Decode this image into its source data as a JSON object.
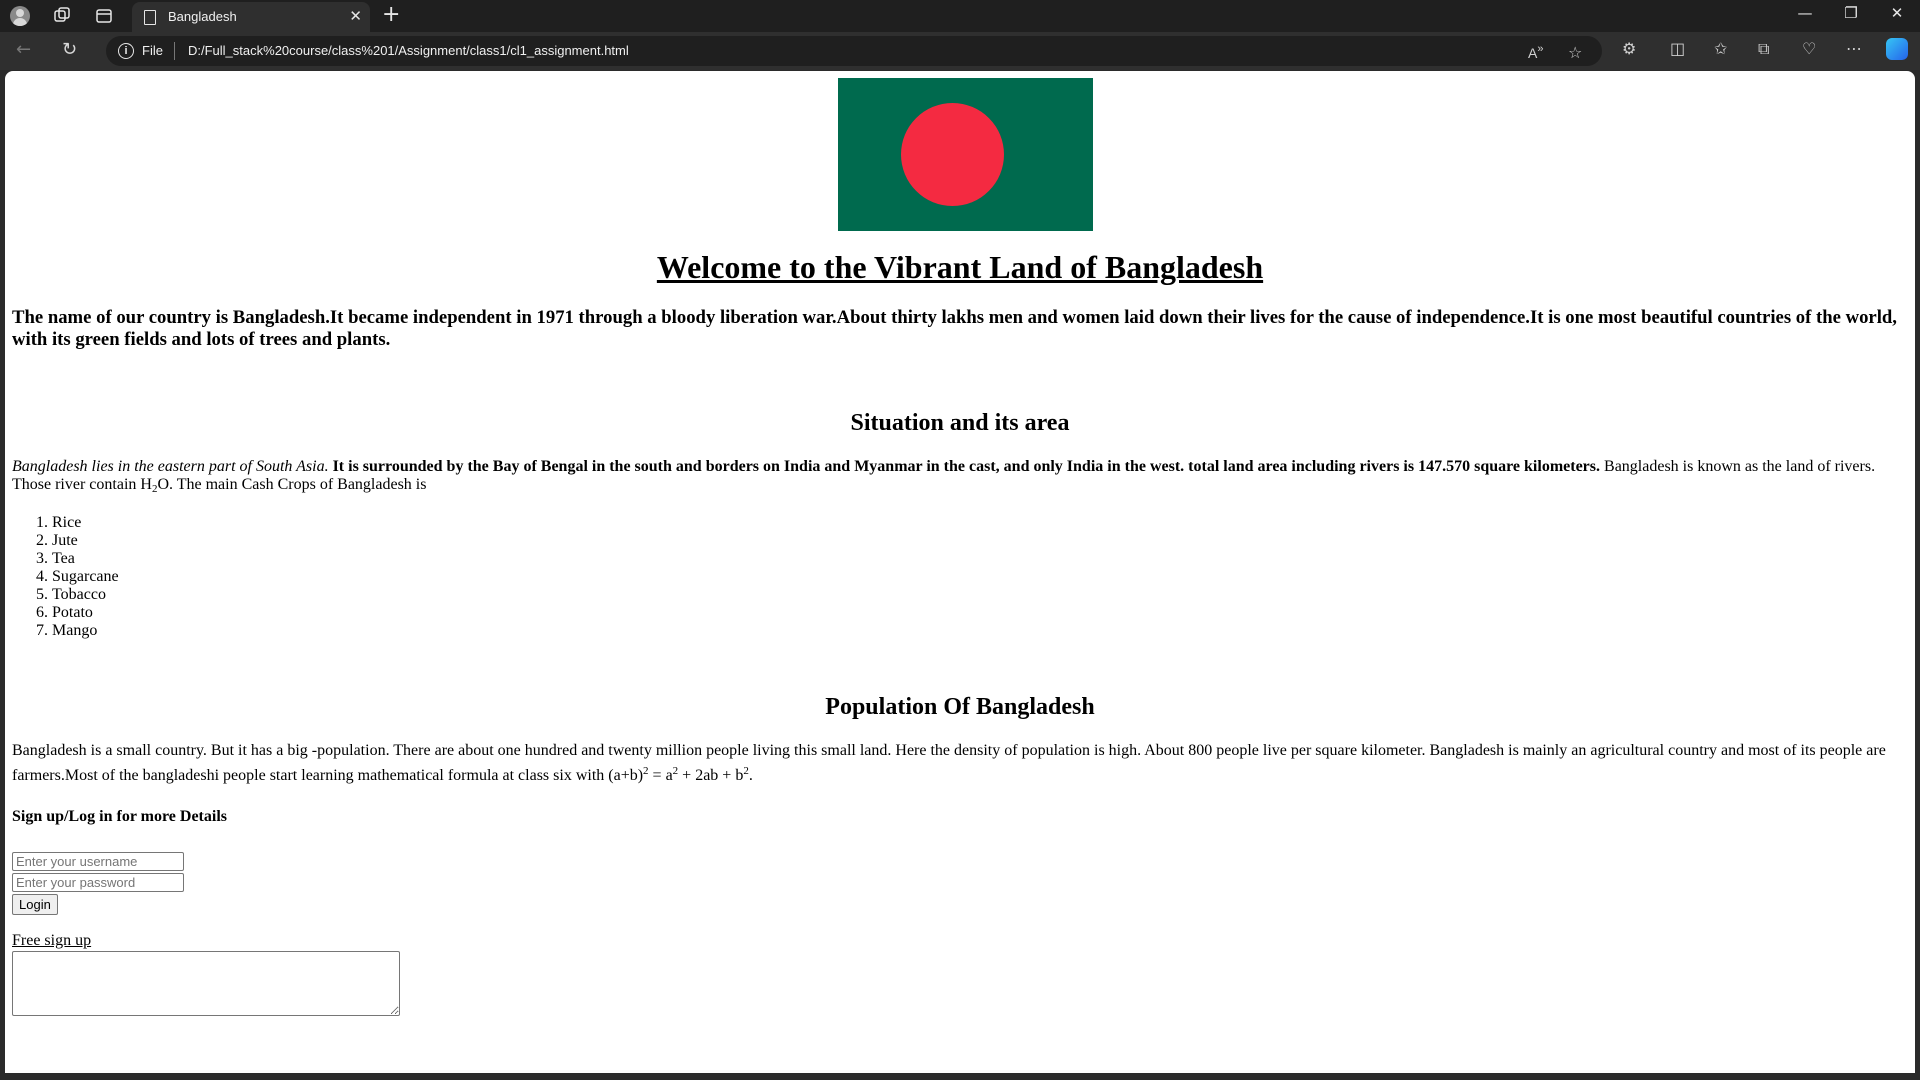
{
  "browser": {
    "tab_title": "Bangladesh",
    "tab_close": "✕",
    "new_tab": "+",
    "file_label": "File",
    "url": "D:/Full_stack%20course/class%201/Assignment/class1/cl1_assignment.html",
    "window_controls": [
      "—",
      "❐",
      "✕"
    ]
  },
  "page": {
    "heading": "Welcome to the Vibrant Land of Bangladesh",
    "intro": "The name of our country is Bangladesh.It became independent in 1971 through a bloody liberation war.About thirty lakhs men and women laid down their lives for the cause of independence.It is one most beautiful countries of the world, with its green fields and lots of trees and plants.",
    "situation_heading": "Situation and its area",
    "situation_italic": "Bangladesh lies in the eastern part of South Asia.",
    "situation_bold": "It is surrounded by the Bay of Bengal in the south and borders on India and Myanmar in the cast, and only India in the west. total land area including rivers is 147.570 square kilometers.",
    "situation_text1": "Bangladesh is known as the land of rivers. Those river contain H",
    "water_sub": "2",
    "situation_text2": "O. The main Cash Crops of Bangladesh is",
    "crops": [
      "Rice",
      "Jute",
      "Tea",
      "Sugarcane",
      "Tobacco",
      "Potato",
      "Mango"
    ],
    "population_heading": "Population Of Bangladesh",
    "population_text": "Bangladesh is a small country. But it has a big -population. There are about one hundred and twenty million people living this small land. Here the density of population is high. About 800 people live per square kilometer. Bangladesh is mainly an agricultural country and most of its people are farmers.Most of the bangladeshi people start learning mathematical formula at class six with (a+b)",
    "formula_exp": "2",
    "formula_part1": " = a",
    "formula_part2": " + 2ab + b",
    "formula_end": ".",
    "signup_heading": "Sign up/Log in for more Details",
    "username_placeholder": "Enter your username",
    "password_placeholder": "Enter your password",
    "login_label": "Login",
    "free_signup": "Free sign up"
  },
  "colors": {
    "flag_green": "#006a4e",
    "flag_red": "#f42a41"
  }
}
